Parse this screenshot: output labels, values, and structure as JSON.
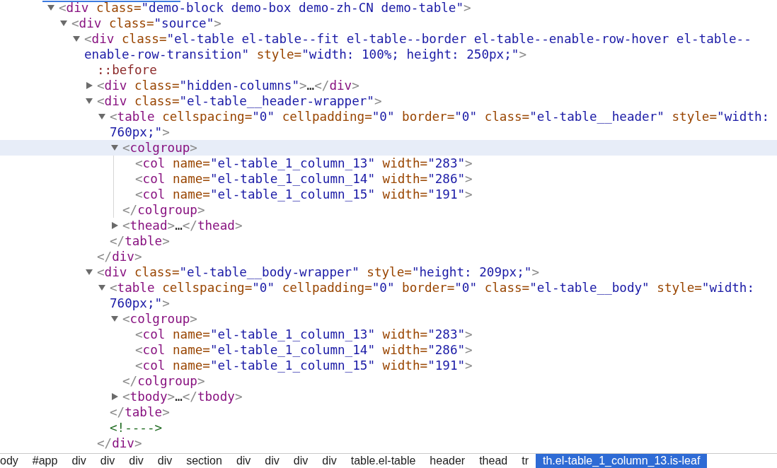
{
  "dom_tree": [
    {
      "highlighted": false,
      "expanded": true,
      "parts": [
        {
          "kind": "punct",
          "text": "<"
        },
        {
          "kind": "tag",
          "text": "div"
        },
        {
          "kind": "attr",
          "text": " class="
        },
        {
          "kind": "value",
          "text": "\"demo-block demo-box demo-zh-CN demo-table\""
        },
        {
          "kind": "punct",
          "text": ">"
        }
      ],
      "children": [
        {
          "highlighted": false,
          "expanded": true,
          "parts": [
            {
              "kind": "punct",
              "text": "<"
            },
            {
              "kind": "tag",
              "text": "div"
            },
            {
              "kind": "attr",
              "text": " class="
            },
            {
              "kind": "value",
              "text": "\"source\""
            },
            {
              "kind": "punct",
              "text": ">"
            }
          ],
          "children": [
            {
              "highlighted": false,
              "expanded": true,
              "parts": [
                {
                  "kind": "punct",
                  "text": "<"
                },
                {
                  "kind": "tag",
                  "text": "div"
                },
                {
                  "kind": "attr",
                  "text": " class="
                },
                {
                  "kind": "value",
                  "text": "\"el-table el-table--fit el-table--border el-table--enable-row-hover el-table--enable-row-transition\""
                },
                {
                  "kind": "attr",
                  "text": " style="
                },
                {
                  "kind": "value",
                  "text": "\"width: 100%; height: 250px;\""
                },
                {
                  "kind": "punct",
                  "text": ">"
                }
              ],
              "children": [
                {
                  "highlighted": false,
                  "parts": [
                    {
                      "kind": "pseudo",
                      "text": "::before"
                    }
                  ]
                },
                {
                  "highlighted": false,
                  "expanded": false,
                  "parts": [
                    {
                      "kind": "punct",
                      "text": "<"
                    },
                    {
                      "kind": "tag",
                      "text": "div"
                    },
                    {
                      "kind": "attr",
                      "text": " class="
                    },
                    {
                      "kind": "value",
                      "text": "\"hidden-columns\""
                    },
                    {
                      "kind": "punct",
                      "text": ">"
                    },
                    {
                      "kind": "text",
                      "text": "…"
                    },
                    {
                      "kind": "punct",
                      "text": "</"
                    },
                    {
                      "kind": "tag",
                      "text": "div"
                    },
                    {
                      "kind": "punct",
                      "text": ">"
                    }
                  ]
                },
                {
                  "highlighted": false,
                  "expanded": true,
                  "parts": [
                    {
                      "kind": "punct",
                      "text": "<"
                    },
                    {
                      "kind": "tag",
                      "text": "div"
                    },
                    {
                      "kind": "attr",
                      "text": " class="
                    },
                    {
                      "kind": "value",
                      "text": "\"el-table__header-wrapper\""
                    },
                    {
                      "kind": "punct",
                      "text": ">"
                    }
                  ],
                  "children": [
                    {
                      "highlighted": false,
                      "expanded": true,
                      "parts": [
                        {
                          "kind": "punct",
                          "text": "<"
                        },
                        {
                          "kind": "tag",
                          "text": "table"
                        },
                        {
                          "kind": "attr",
                          "text": " cellspacing="
                        },
                        {
                          "kind": "value",
                          "text": "\"0\""
                        },
                        {
                          "kind": "attr",
                          "text": " cellpadding="
                        },
                        {
                          "kind": "value",
                          "text": "\"0\""
                        },
                        {
                          "kind": "attr",
                          "text": " border="
                        },
                        {
                          "kind": "value",
                          "text": "\"0\""
                        },
                        {
                          "kind": "attr",
                          "text": " class="
                        },
                        {
                          "kind": "value",
                          "text": "\"el-table__header\""
                        },
                        {
                          "kind": "attr",
                          "text": " style="
                        },
                        {
                          "kind": "value",
                          "text": "\"width: 760px;\""
                        },
                        {
                          "kind": "punct",
                          "text": ">"
                        }
                      ],
                      "children": [
                        {
                          "highlighted": true,
                          "expanded": true,
                          "parts": [
                            {
                              "kind": "punct",
                              "text": "<"
                            },
                            {
                              "kind": "tag",
                              "text": "colgroup"
                            },
                            {
                              "kind": "punct",
                              "text": ">"
                            }
                          ],
                          "children": [
                            {
                              "highlighted": false,
                              "parts": [
                                {
                                  "kind": "punct",
                                  "text": "<"
                                },
                                {
                                  "kind": "tag",
                                  "text": "col"
                                },
                                {
                                  "kind": "attr",
                                  "text": " name="
                                },
                                {
                                  "kind": "value",
                                  "text": "\"el-table_1_column_13\""
                                },
                                {
                                  "kind": "attr",
                                  "text": " width="
                                },
                                {
                                  "kind": "value",
                                  "text": "\"283\""
                                },
                                {
                                  "kind": "punct",
                                  "text": ">"
                                }
                              ]
                            },
                            {
                              "highlighted": false,
                              "parts": [
                                {
                                  "kind": "punct",
                                  "text": "<"
                                },
                                {
                                  "kind": "tag",
                                  "text": "col"
                                },
                                {
                                  "kind": "attr",
                                  "text": " name="
                                },
                                {
                                  "kind": "value",
                                  "text": "\"el-table_1_column_14\""
                                },
                                {
                                  "kind": "attr",
                                  "text": " width="
                                },
                                {
                                  "kind": "value",
                                  "text": "\"286\""
                                },
                                {
                                  "kind": "punct",
                                  "text": ">"
                                }
                              ]
                            },
                            {
                              "highlighted": false,
                              "parts": [
                                {
                                  "kind": "punct",
                                  "text": "<"
                                },
                                {
                                  "kind": "tag",
                                  "text": "col"
                                },
                                {
                                  "kind": "attr",
                                  "text": " name="
                                },
                                {
                                  "kind": "value",
                                  "text": "\"el-table_1_column_15\""
                                },
                                {
                                  "kind": "attr",
                                  "text": " width="
                                },
                                {
                                  "kind": "value",
                                  "text": "\"191\""
                                },
                                {
                                  "kind": "punct",
                                  "text": ">"
                                }
                              ]
                            }
                          ],
                          "closing": [
                            {
                              "kind": "punct",
                              "text": "</"
                            },
                            {
                              "kind": "tag",
                              "text": "colgroup"
                            },
                            {
                              "kind": "punct",
                              "text": ">"
                            }
                          ]
                        },
                        {
                          "highlighted": false,
                          "expanded": false,
                          "parts": [
                            {
                              "kind": "punct",
                              "text": "<"
                            },
                            {
                              "kind": "tag",
                              "text": "thead"
                            },
                            {
                              "kind": "punct",
                              "text": ">"
                            },
                            {
                              "kind": "text",
                              "text": "…"
                            },
                            {
                              "kind": "punct",
                              "text": "</"
                            },
                            {
                              "kind": "tag",
                              "text": "thead"
                            },
                            {
                              "kind": "punct",
                              "text": ">"
                            }
                          ]
                        }
                      ],
                      "closing": [
                        {
                          "kind": "punct",
                          "text": "</"
                        },
                        {
                          "kind": "tag",
                          "text": "table"
                        },
                        {
                          "kind": "punct",
                          "text": ">"
                        }
                      ]
                    }
                  ],
                  "closing": [
                    {
                      "kind": "punct",
                      "text": "</"
                    },
                    {
                      "kind": "tag",
                      "text": "div"
                    },
                    {
                      "kind": "punct",
                      "text": ">"
                    }
                  ]
                },
                {
                  "highlighted": false,
                  "expanded": true,
                  "parts": [
                    {
                      "kind": "punct",
                      "text": "<"
                    },
                    {
                      "kind": "tag",
                      "text": "div"
                    },
                    {
                      "kind": "attr",
                      "text": " class="
                    },
                    {
                      "kind": "value",
                      "text": "\"el-table__body-wrapper\""
                    },
                    {
                      "kind": "attr",
                      "text": " style="
                    },
                    {
                      "kind": "value",
                      "text": "\"height: 209px;\""
                    },
                    {
                      "kind": "punct",
                      "text": ">"
                    }
                  ],
                  "children": [
                    {
                      "highlighted": false,
                      "expanded": true,
                      "parts": [
                        {
                          "kind": "punct",
                          "text": "<"
                        },
                        {
                          "kind": "tag",
                          "text": "table"
                        },
                        {
                          "kind": "attr",
                          "text": " cellspacing="
                        },
                        {
                          "kind": "value",
                          "text": "\"0\""
                        },
                        {
                          "kind": "attr",
                          "text": " cellpadding="
                        },
                        {
                          "kind": "value",
                          "text": "\"0\""
                        },
                        {
                          "kind": "attr",
                          "text": " border="
                        },
                        {
                          "kind": "value",
                          "text": "\"0\""
                        },
                        {
                          "kind": "attr",
                          "text": " class="
                        },
                        {
                          "kind": "value",
                          "text": "\"el-table__body\""
                        },
                        {
                          "kind": "attr",
                          "text": " style="
                        },
                        {
                          "kind": "value",
                          "text": "\"width: 760px;\""
                        },
                        {
                          "kind": "punct",
                          "text": ">"
                        }
                      ],
                      "children": [
                        {
                          "highlighted": false,
                          "expanded": true,
                          "parts": [
                            {
                              "kind": "punct",
                              "text": "<"
                            },
                            {
                              "kind": "tag",
                              "text": "colgroup"
                            },
                            {
                              "kind": "punct",
                              "text": ">"
                            }
                          ],
                          "children": [
                            {
                              "highlighted": false,
                              "parts": [
                                {
                                  "kind": "punct",
                                  "text": "<"
                                },
                                {
                                  "kind": "tag",
                                  "text": "col"
                                },
                                {
                                  "kind": "attr",
                                  "text": " name="
                                },
                                {
                                  "kind": "value",
                                  "text": "\"el-table_1_column_13\""
                                },
                                {
                                  "kind": "attr",
                                  "text": " width="
                                },
                                {
                                  "kind": "value",
                                  "text": "\"283\""
                                },
                                {
                                  "kind": "punct",
                                  "text": ">"
                                }
                              ]
                            },
                            {
                              "highlighted": false,
                              "parts": [
                                {
                                  "kind": "punct",
                                  "text": "<"
                                },
                                {
                                  "kind": "tag",
                                  "text": "col"
                                },
                                {
                                  "kind": "attr",
                                  "text": " name="
                                },
                                {
                                  "kind": "value",
                                  "text": "\"el-table_1_column_14\""
                                },
                                {
                                  "kind": "attr",
                                  "text": " width="
                                },
                                {
                                  "kind": "value",
                                  "text": "\"286\""
                                },
                                {
                                  "kind": "punct",
                                  "text": ">"
                                }
                              ]
                            },
                            {
                              "highlighted": false,
                              "parts": [
                                {
                                  "kind": "punct",
                                  "text": "<"
                                },
                                {
                                  "kind": "tag",
                                  "text": "col"
                                },
                                {
                                  "kind": "attr",
                                  "text": " name="
                                },
                                {
                                  "kind": "value",
                                  "text": "\"el-table_1_column_15\""
                                },
                                {
                                  "kind": "attr",
                                  "text": " width="
                                },
                                {
                                  "kind": "value",
                                  "text": "\"191\""
                                },
                                {
                                  "kind": "punct",
                                  "text": ">"
                                }
                              ]
                            }
                          ],
                          "closing": [
                            {
                              "kind": "punct",
                              "text": "</"
                            },
                            {
                              "kind": "tag",
                              "text": "colgroup"
                            },
                            {
                              "kind": "punct",
                              "text": ">"
                            }
                          ]
                        },
                        {
                          "highlighted": false,
                          "expanded": false,
                          "parts": [
                            {
                              "kind": "punct",
                              "text": "<"
                            },
                            {
                              "kind": "tag",
                              "text": "tbody"
                            },
                            {
                              "kind": "punct",
                              "text": ">"
                            },
                            {
                              "kind": "text",
                              "text": "…"
                            },
                            {
                              "kind": "punct",
                              "text": "</"
                            },
                            {
                              "kind": "tag",
                              "text": "tbody"
                            },
                            {
                              "kind": "punct",
                              "text": ">"
                            }
                          ]
                        }
                      ],
                      "closing": [
                        {
                          "kind": "punct",
                          "text": "</"
                        },
                        {
                          "kind": "tag",
                          "text": "table"
                        },
                        {
                          "kind": "punct",
                          "text": ">"
                        }
                      ]
                    },
                    {
                      "highlighted": false,
                      "parts": [
                        {
                          "kind": "comment",
                          "text": "<!---->"
                        }
                      ]
                    }
                  ],
                  "closing": [
                    {
                      "kind": "punct",
                      "text": "</"
                    },
                    {
                      "kind": "tag",
                      "text": "div"
                    },
                    {
                      "kind": "punct",
                      "text": ">"
                    }
                  ]
                }
              ]
            }
          ]
        }
      ]
    }
  ],
  "breadcrumbs": [
    {
      "label": "ody",
      "selected": false
    },
    {
      "label": "#app",
      "selected": false
    },
    {
      "label": "div",
      "selected": false
    },
    {
      "label": "div",
      "selected": false
    },
    {
      "label": "div",
      "selected": false
    },
    {
      "label": "div",
      "selected": false
    },
    {
      "label": "section",
      "selected": false
    },
    {
      "label": "div",
      "selected": false
    },
    {
      "label": "div",
      "selected": false
    },
    {
      "label": "div",
      "selected": false
    },
    {
      "label": "div",
      "selected": false
    },
    {
      "label": "table.el-table",
      "selected": false
    },
    {
      "label": "header",
      "selected": false
    },
    {
      "label": "thead",
      "selected": false
    },
    {
      "label": "tr",
      "selected": false
    },
    {
      "label": "th.el-table_1_column_13.is-leaf",
      "selected": true
    }
  ]
}
